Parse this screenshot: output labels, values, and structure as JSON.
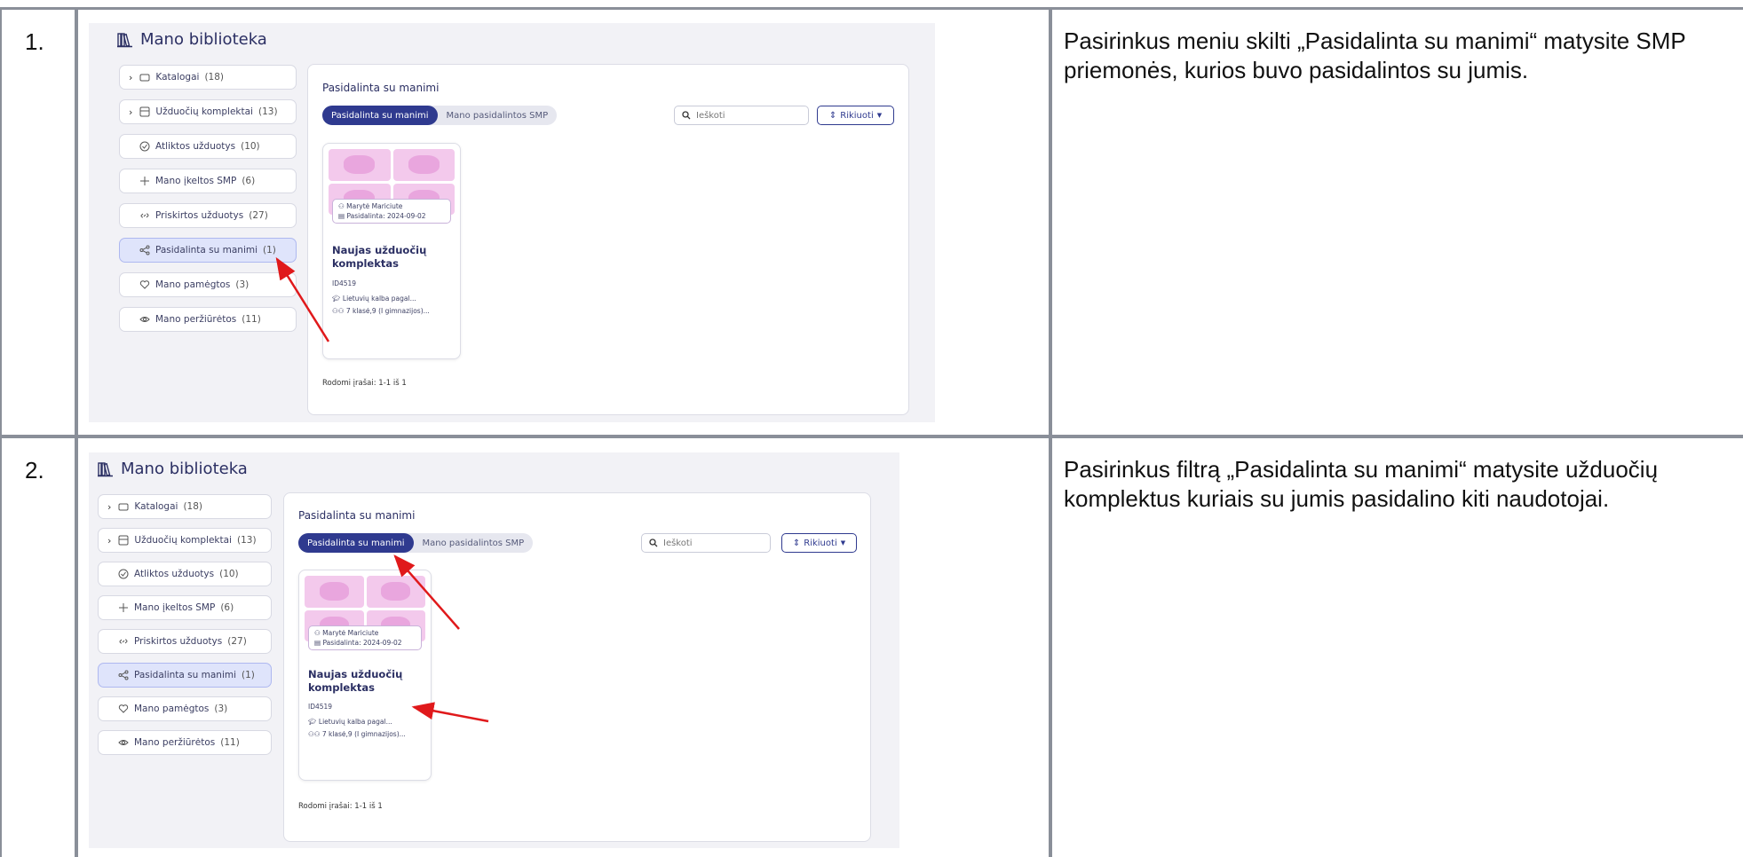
{
  "rows": [
    {
      "number": "1.",
      "description": "Pasirinkus meniu skilti „Pasidalinta su manimi“ matysite SMP priemonės, kurios buvo pasidalintos su jumis."
    },
    {
      "number": "2.",
      "description": "Pasirinkus filtrą „Pasidalinta su manimi“ matysite užduočių komplektus kuriais su jumis pasidalino kiti naudotojai."
    }
  ],
  "library": {
    "title": "Mano biblioteka",
    "sidebar": [
      {
        "label": "Katalogai",
        "count": "(18)",
        "icon": "catalog-icon",
        "expandable": true
      },
      {
        "label": "Užduočių komplektai",
        "count": "(13)",
        "icon": "task-set-icon",
        "expandable": true
      },
      {
        "label": "Atliktos užduotys",
        "count": "(10)",
        "icon": "check-circle-icon"
      },
      {
        "label": "Mano įkeltos SMP",
        "count": "(6)",
        "icon": "plus-icon"
      },
      {
        "label": "Priskirtos užduotys",
        "count": "(27)",
        "icon": "link-icon"
      },
      {
        "label": "Pasidalinta su manimi",
        "count": "(1)",
        "icon": "share-icon",
        "active": true
      },
      {
        "label": "Mano pamėgtos",
        "count": "(3)",
        "icon": "heart-icon"
      },
      {
        "label": "Mano peržiūrėtos",
        "count": "(11)",
        "icon": "eye-icon"
      }
    ],
    "header": "Pasidalinta su manimi",
    "tabs": [
      "Pasidalinta su manimi",
      "Mano pasidalintos SMP"
    ],
    "search_placeholder": "Ieškoti",
    "sort_label": "Rikiuoti",
    "card": {
      "owner": "Marytė Mariciute",
      "shared": "Pasidalinta: 2024-09-02",
      "title": "Naujas užduočių komplektas",
      "id": "ID4519",
      "subject": "Lietuvių kalba pagal...",
      "grades": "7 klasė,9 (I gimnazijos)..."
    },
    "footer": "Rodomi įrašai: 1-1 iš 1"
  },
  "colors": {
    "accent": "#2f3a8f",
    "active_bg": "#dfe4fb",
    "arrow": "#e0191b",
    "thumb": "#f3c9ec"
  }
}
